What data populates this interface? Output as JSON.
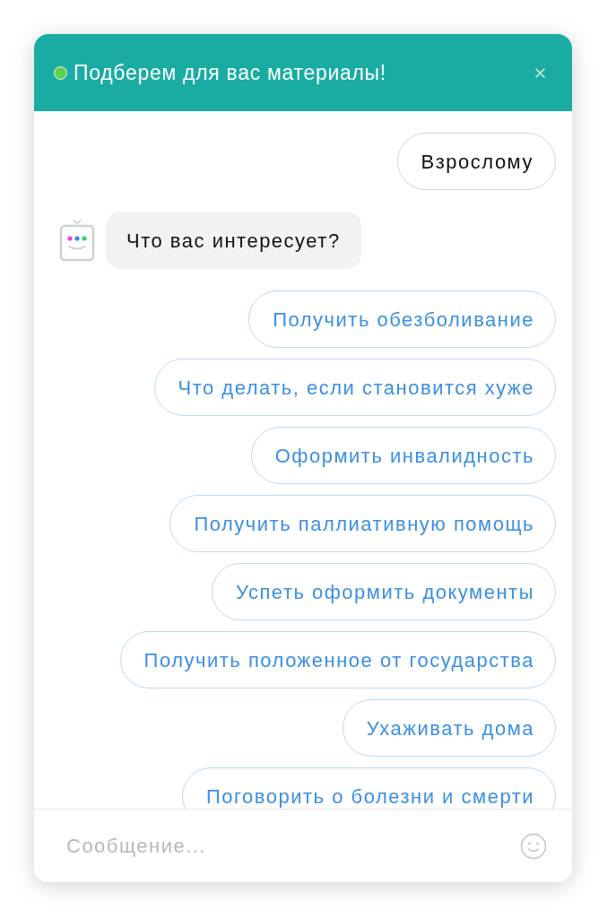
{
  "header": {
    "title": "Подберем для вас материалы!",
    "online": true
  },
  "messages": [
    {
      "kind": "user",
      "text": "Взрослому"
    },
    {
      "kind": "bot",
      "text": "Что вас интересует?"
    }
  ],
  "quick_replies": [
    {
      "label": "Получить обезболивание"
    },
    {
      "label": "Что делать, если становится хуже"
    },
    {
      "label": "Оформить инвалидность"
    },
    {
      "label": "Получить паллиативную помощь"
    },
    {
      "label": "Успеть оформить документы"
    },
    {
      "label": "Получить положенное от государства"
    },
    {
      "label": "Ухаживать дома"
    },
    {
      "label": "Поговорить о болезни и смерти"
    }
  ],
  "composer": {
    "placeholder": "Сообщение..."
  }
}
